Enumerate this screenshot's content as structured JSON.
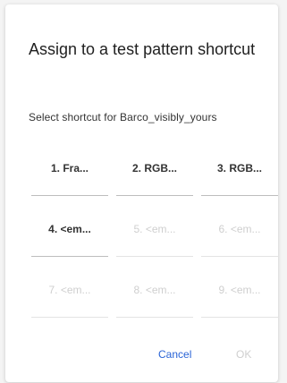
{
  "dialog": {
    "title": "Assign to a test pattern shortcut",
    "subtitle": "Select shortcut for Barco_visibly_yours",
    "shortcuts": [
      {
        "label": "1. Fra...",
        "enabled": true
      },
      {
        "label": "2. RGB...",
        "enabled": true
      },
      {
        "label": "3. RGB...",
        "enabled": true
      },
      {
        "label": "4. <em...",
        "enabled": true
      },
      {
        "label": "5. <em...",
        "enabled": false
      },
      {
        "label": "6. <em...",
        "enabled": false
      },
      {
        "label": "7. <em...",
        "enabled": false
      },
      {
        "label": "8. <em...",
        "enabled": false
      },
      {
        "label": "9. <em...",
        "enabled": false
      }
    ],
    "cancel_label": "Cancel",
    "ok_label": "OK"
  },
  "colors": {
    "accent": "#2a64d6",
    "text": "#333333",
    "disabled": "#cfcfcf"
  }
}
